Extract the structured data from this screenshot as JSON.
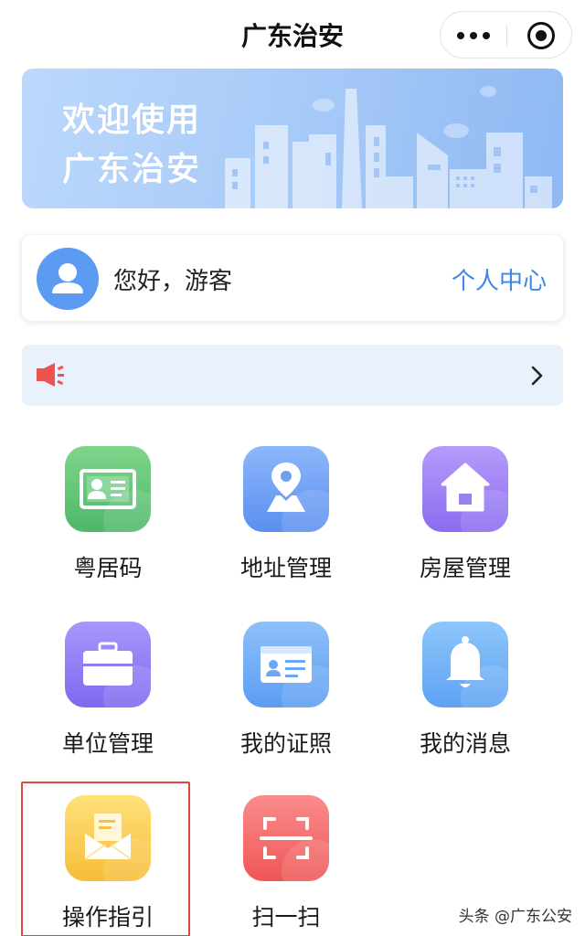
{
  "header": {
    "title": "广东治安",
    "more_icon": "more-dots-icon",
    "close_icon": "target-close-icon"
  },
  "banner": {
    "line1": "欢迎使用",
    "line2": "广东治安"
  },
  "user_card": {
    "greeting": "您好，游客",
    "personal_center": "个人中心",
    "avatar_icon": "user-avatar-icon"
  },
  "notice": {
    "speaker_icon": "speaker-icon",
    "arrow_icon": "chevron-right-icon",
    "speaker_color": "#ef5350"
  },
  "grid": [
    {
      "label": "粤居码",
      "icon": "id-card-icon",
      "from": "#7fd58a",
      "to": "#4db86a"
    },
    {
      "label": "地址管理",
      "icon": "location-map-icon",
      "from": "#8db7fb",
      "to": "#5b8ff0"
    },
    {
      "label": "房屋管理",
      "icon": "house-icon",
      "from": "#b69bfb",
      "to": "#8a6cf0"
    },
    {
      "label": "单位管理",
      "icon": "briefcase-icon",
      "from": "#a996fb",
      "to": "#7d69ef"
    },
    {
      "label": "我的证照",
      "icon": "license-card-icon",
      "from": "#8ec1fb",
      "to": "#5c9cf2"
    },
    {
      "label": "我的消息",
      "icon": "bell-icon",
      "from": "#8ec6fb",
      "to": "#5ea2f3"
    },
    {
      "label": "操作指引",
      "icon": "guide-envelope-icon",
      "from": "#ffe07a",
      "to": "#f7bd3a"
    },
    {
      "label": "扫一扫",
      "icon": "scan-icon",
      "from": "#fb8c8c",
      "to": "#ef5656"
    }
  ],
  "watermark": "头条 @广东公安"
}
